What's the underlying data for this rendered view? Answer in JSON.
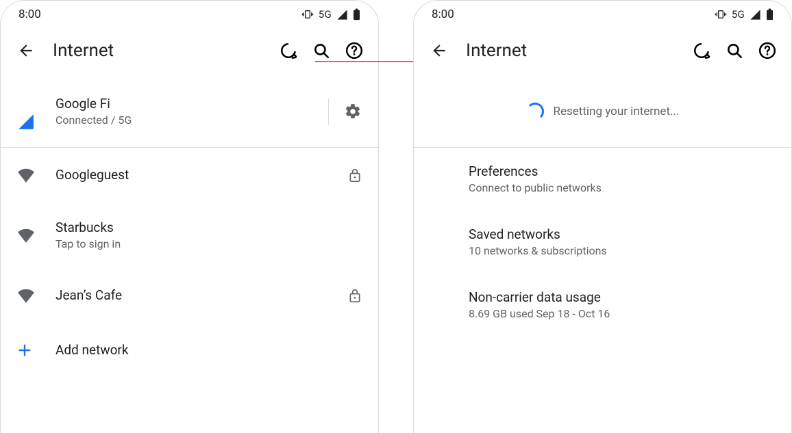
{
  "status": {
    "time": "8:00",
    "net": "5G"
  },
  "appbar": {
    "title": "Internet"
  },
  "left": {
    "carrier": {
      "name": "Google Fi",
      "status": "Connected / 5G"
    },
    "wifi": [
      {
        "name": "Googleguest",
        "sub": "",
        "locked": true
      },
      {
        "name": "Starbucks",
        "sub": "Tap to sign in",
        "locked": false
      },
      {
        "name": "Jean’s Cafe",
        "sub": "",
        "locked": true
      }
    ],
    "add": "Add network"
  },
  "right": {
    "resetting": "Resetting your internet...",
    "items": [
      {
        "title": "Preferences",
        "sub": "Connect to public networks"
      },
      {
        "title": "Saved networks",
        "sub": "10 networks & subscriptions"
      },
      {
        "title": "Non-carrier data usage",
        "sub": "8.69 GB used Sep 18 - Oct 16"
      }
    ]
  }
}
